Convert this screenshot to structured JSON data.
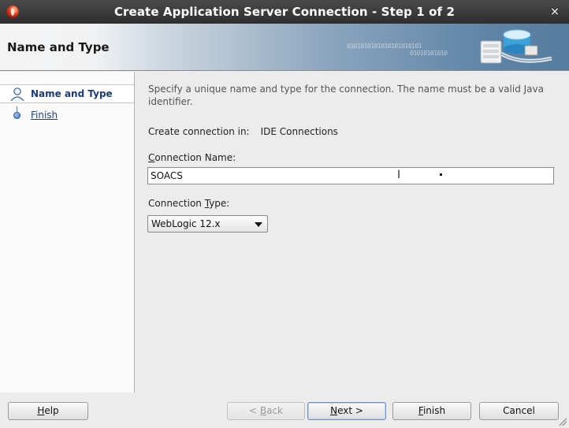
{
  "window": {
    "title": "Create Application Server Connection - Step 1 of 2",
    "close_glyph": "×"
  },
  "banner": {
    "heading": "Name and Type",
    "binary_text": "0101010101010101010101",
    "binary_text_2": "01010101010",
    "graphic_icon": "server-connection-graphic"
  },
  "nav": {
    "items": [
      {
        "label": "Name and Type",
        "icon": "person-icon",
        "state": "current"
      },
      {
        "label": "Finish",
        "icon": "dot-icon",
        "state": "link"
      }
    ]
  },
  "main": {
    "description": "Specify a unique name and type for the connection. The name must be a valid Java identifier.",
    "create_in_label": "Create connection in:",
    "create_in_value": "IDE Connections",
    "connection_name_label_mnemonic": "C",
    "connection_name_label_rest": "onnection Name:",
    "connection_name_value": "SOACS",
    "connection_type_label_prefix": "Connection ",
    "connection_type_label_mnemonic": "T",
    "connection_type_label_rest": "ype:",
    "connection_type_value": "WebLogic 12.x"
  },
  "buttons": {
    "help": {
      "mnemonic": "H",
      "rest": "elp"
    },
    "back": {
      "prefix": "< ",
      "mnemonic": "B",
      "rest": "ack"
    },
    "next": {
      "mnemonic": "N",
      "rest": "ext >"
    },
    "finish": {
      "mnemonic": "F",
      "rest": "inish"
    },
    "cancel": "Cancel"
  },
  "colors": {
    "title_bar": "#3a3a3a",
    "nav_active_text": "#1b3a76",
    "link": "#1d3f8a",
    "banner_blue": "#557b9e"
  }
}
